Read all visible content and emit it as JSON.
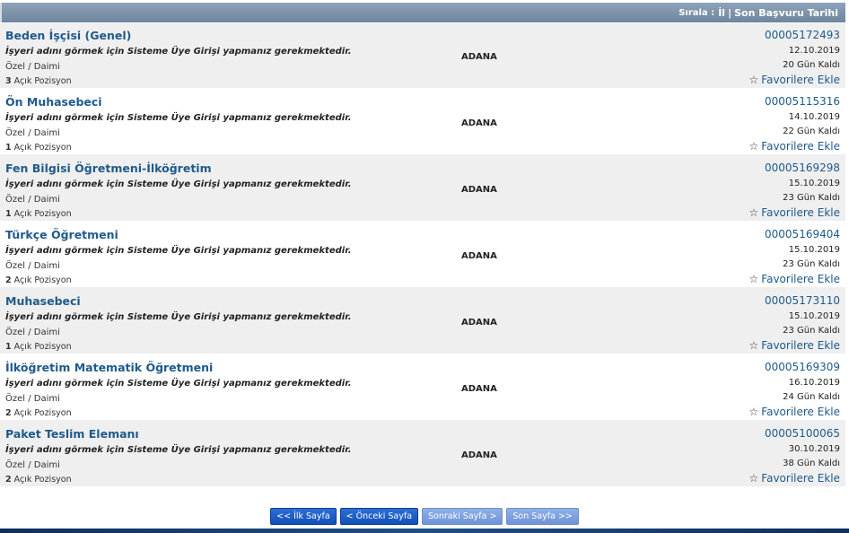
{
  "header": {
    "sort_label": "Sırala :",
    "sort_il": "İl",
    "separator": "|",
    "sort_date": "Son Başvuru Tarihi"
  },
  "listings": [
    {
      "title": "Beden İşçisi (Genel)",
      "note": "İşyeri adını görmek için Sisteme Üye Girişi yapmanız gerekmektedir.",
      "type": "Özel / Daimi",
      "positions": "3",
      "positions_label": "Açık Pozisyon",
      "city": "ADANA",
      "code": "00005172493",
      "date": "12.10.2019",
      "days_left": "20 Gün Kaldı",
      "fav": "Favorilere Ekle"
    },
    {
      "title": "Ön Muhasebeci",
      "note": "İşyeri adını görmek için Sisteme Üye Girişi yapmanız gerekmektedir.",
      "type": "Özel / Daimi",
      "positions": "1",
      "positions_label": "Açık Pozisyon",
      "city": "ADANA",
      "code": "00005115316",
      "date": "14.10.2019",
      "days_left": "22 Gün Kaldı",
      "fav": "Favorilere Ekle"
    },
    {
      "title": "Fen Bilgisi Öğretmeni-İlköğretim",
      "note": "İşyeri adını görmek için Sisteme Üye Girişi yapmanız gerekmektedir.",
      "type": "Özel / Daimi",
      "positions": "1",
      "positions_label": "Açık Pozisyon",
      "city": "ADANA",
      "code": "00005169298",
      "date": "15.10.2019",
      "days_left": "23 Gün Kaldı",
      "fav": "Favorilere Ekle"
    },
    {
      "title": "Türkçe Öğretmeni",
      "note": "İşyeri adını görmek için Sisteme Üye Girişi yapmanız gerekmektedir.",
      "type": "Özel / Daimi",
      "positions": "2",
      "positions_label": "Açık Pozisyon",
      "city": "ADANA",
      "code": "00005169404",
      "date": "15.10.2019",
      "days_left": "23 Gün Kaldı",
      "fav": "Favorilere Ekle"
    },
    {
      "title": "Muhasebeci",
      "note": "İşyeri adını görmek için Sisteme Üye Girişi yapmanız gerekmektedir.",
      "type": "Özel / Daimi",
      "positions": "1",
      "positions_label": "Açık Pozisyon",
      "city": "ADANA",
      "code": "00005173110",
      "date": "15.10.2019",
      "days_left": "23 Gün Kaldı",
      "fav": "Favorilere Ekle"
    },
    {
      "title": "İlköğretim Matematik Öğretmeni",
      "note": "İşyeri adını görmek için Sisteme Üye Girişi yapmanız gerekmektedir.",
      "type": "Özel / Daimi",
      "positions": "2",
      "positions_label": "Açık Pozisyon",
      "city": "ADANA",
      "code": "00005169309",
      "date": "16.10.2019",
      "days_left": "24 Gün Kaldı",
      "fav": "Favorilere Ekle"
    },
    {
      "title": "Paket Teslim Elemanı",
      "note": "İşyeri adını görmek için Sisteme Üye Girişi yapmanız gerekmektedir.",
      "type": "Özel / Daimi",
      "positions": "2",
      "positions_label": "Açık Pozisyon",
      "city": "ADANA",
      "code": "00005100065",
      "date": "30.10.2019",
      "days_left": "38 Gün Kaldı",
      "fav": "Favorilere Ekle"
    }
  ],
  "pager": {
    "first": "<< İlk Sayfa",
    "prev": "< Önceki Sayfa",
    "next": "Sonraki Sayfa >",
    "last": "Son Sayfa >>"
  },
  "icons": {
    "favorite": "star-outline-icon"
  },
  "colors": {
    "link": "#1f5a8c",
    "header": "#7b90a7",
    "pager_active": "#1a5cc6"
  }
}
